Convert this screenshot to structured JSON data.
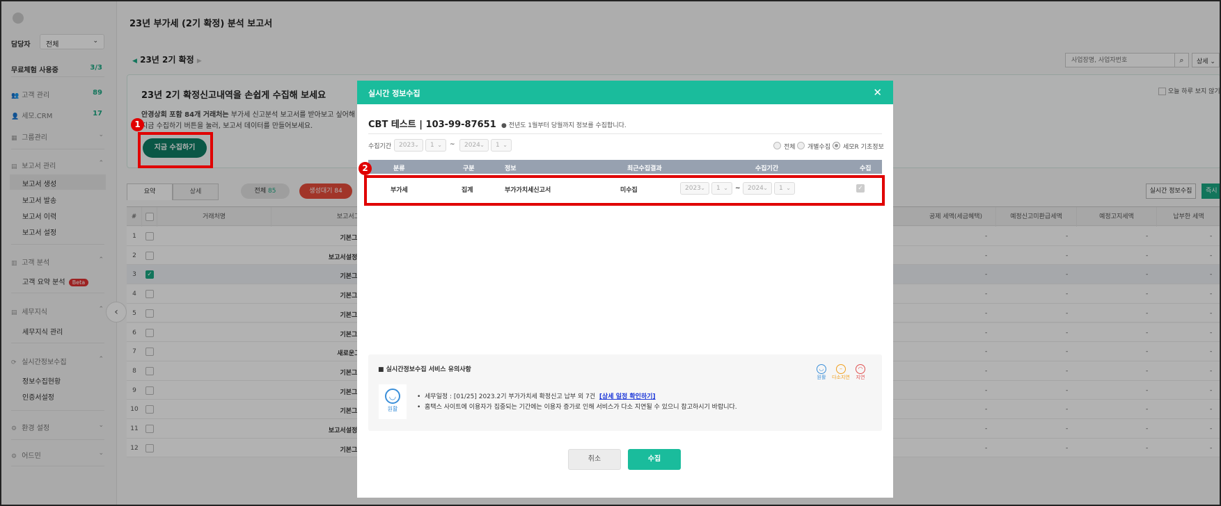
{
  "sidebar": {
    "manager_label": "담당자",
    "manager_select": "전체",
    "trial_label": "무료체험 사용중",
    "trial_count": "3/3",
    "client_mgmt": "고객 관리",
    "client_count": "89",
    "semo_crm": "세모.CRM",
    "crm_count": "17",
    "group_mgmt": "그룹관리",
    "report_mgmt": "보고서 관리",
    "report_create": "보고서 생성",
    "report_send": "보고서 발송",
    "report_history": "보고서 이력",
    "report_settings": "보고서 설정",
    "client_analysis": "고객 분석",
    "client_summary": "고객 요약 분석",
    "beta": "Beta",
    "tax_knowledge": "세무지식",
    "tax_knowledge_mgmt": "세무지식 관리",
    "realtime_collect": "실시간정보수집",
    "collect_status": "정보수집현황",
    "cert_settings": "인증서설정",
    "env_settings": "환경 설정",
    "admin": "어드민"
  },
  "page": {
    "title": "23년 부가세 (2기 확정) 분석 보고서",
    "period": "23년 2기 확정",
    "search_placeholder": "사업장명, 사업자번호",
    "detail_button": "상세",
    "banner_title": "23년 2기 확정신고내역을 손쉽게 수집해 보세요",
    "banner_line1_bold": "안경상회 포함 84개 거래처는",
    "banner_line1_rest": "부가세 신고분석 보고서를 받아보고 싶어해",
    "banner_line2": "지금 수집하기 버튼을 눌러, 보고서 데이터를 만들어보세요.",
    "collect_now_button": "지금 수집하기",
    "hide_today": "오늘 하루 보지 않기",
    "tab_summary": "요약",
    "tab_detail": "상세",
    "filter_all": "전체",
    "filter_all_count": "85",
    "filter_pending": "생성대기 84",
    "realtime_button": "실시간 정보수집",
    "instant_button": "즉시 "
  },
  "table": {
    "headers": [
      "#",
      "거래처명",
      "보고서그룹",
      "공제 세액(세금혜택)",
      "예정신고미환급세액",
      "예정고지세액",
      "납부한 세액"
    ],
    "rows": [
      {
        "num": "1",
        "group": "기본그룹",
        "checked": false
      },
      {
        "num": "2",
        "group": "보고서설정테스트",
        "checked": false
      },
      {
        "num": "3",
        "group": "기본그룹",
        "checked": true
      },
      {
        "num": "4",
        "group": "기본그룹",
        "checked": false
      },
      {
        "num": "5",
        "group": "기본그룹",
        "checked": false
      },
      {
        "num": "6",
        "group": "기본그룹",
        "checked": false
      },
      {
        "num": "7",
        "group": "새로운그룹",
        "checked": false
      },
      {
        "num": "8",
        "group": "기본그룹",
        "checked": false
      },
      {
        "num": "9",
        "group": "기본그룹",
        "checked": false
      },
      {
        "num": "10",
        "group": "기본그룹",
        "checked": false
      },
      {
        "num": "11",
        "group": "보고서설정테스트",
        "checked": false
      },
      {
        "num": "12",
        "group": "기본그룹",
        "checked": false
      }
    ],
    "dash": "-"
  },
  "modal": {
    "title": "실시간 정보수집",
    "company": "CBT 테스트 | 103-99-87651",
    "notice": "전년도 1월부터 당월까지 정보를 수집합니다.",
    "period_label": "수집기간",
    "from_year": "2023",
    "from_month": "1",
    "tilde": "~",
    "to_year": "2024",
    "to_month": "1",
    "radio_all": "전체",
    "radio_individual": "개별수집",
    "radio_semor": "세모R 기초정보",
    "headers": [
      "분류",
      "구분",
      "정보",
      "최근수집결과",
      "수집기간",
      "수집"
    ],
    "row": {
      "category": "부가세",
      "type": "집계",
      "info": "부가가치세신고서",
      "result": "미수집",
      "from_year": "2023",
      "from_month": "1",
      "to_year": "2024",
      "to_month": "1"
    },
    "notes_title": "실시간정보수집 서비스 유의사항",
    "status_smooth": "원활",
    "status_slow": "다소지연",
    "status_delay": "지연",
    "status_big": "원활",
    "note1_prefix": "세무일정 : [01/25] 2023.2기 부가가치세 확정신고 납부 외 7건",
    "note1_link": "[상세 일정 확인하기]",
    "note2": "홈택스 사이트에 이용자가 집중되는 기간에는 이용자 증가로 인해 서비스가 다소 지연될 수 있으니 참고하시기 바랍니다.",
    "cancel": "취소",
    "submit": "수집"
  },
  "annotations": {
    "badge1": "1",
    "badge2": "2"
  },
  "colors": {
    "accent": "#1abc9c",
    "primary_dark": "#0f7d65",
    "highlight": "#e00000",
    "pending": "#e74c3c"
  }
}
